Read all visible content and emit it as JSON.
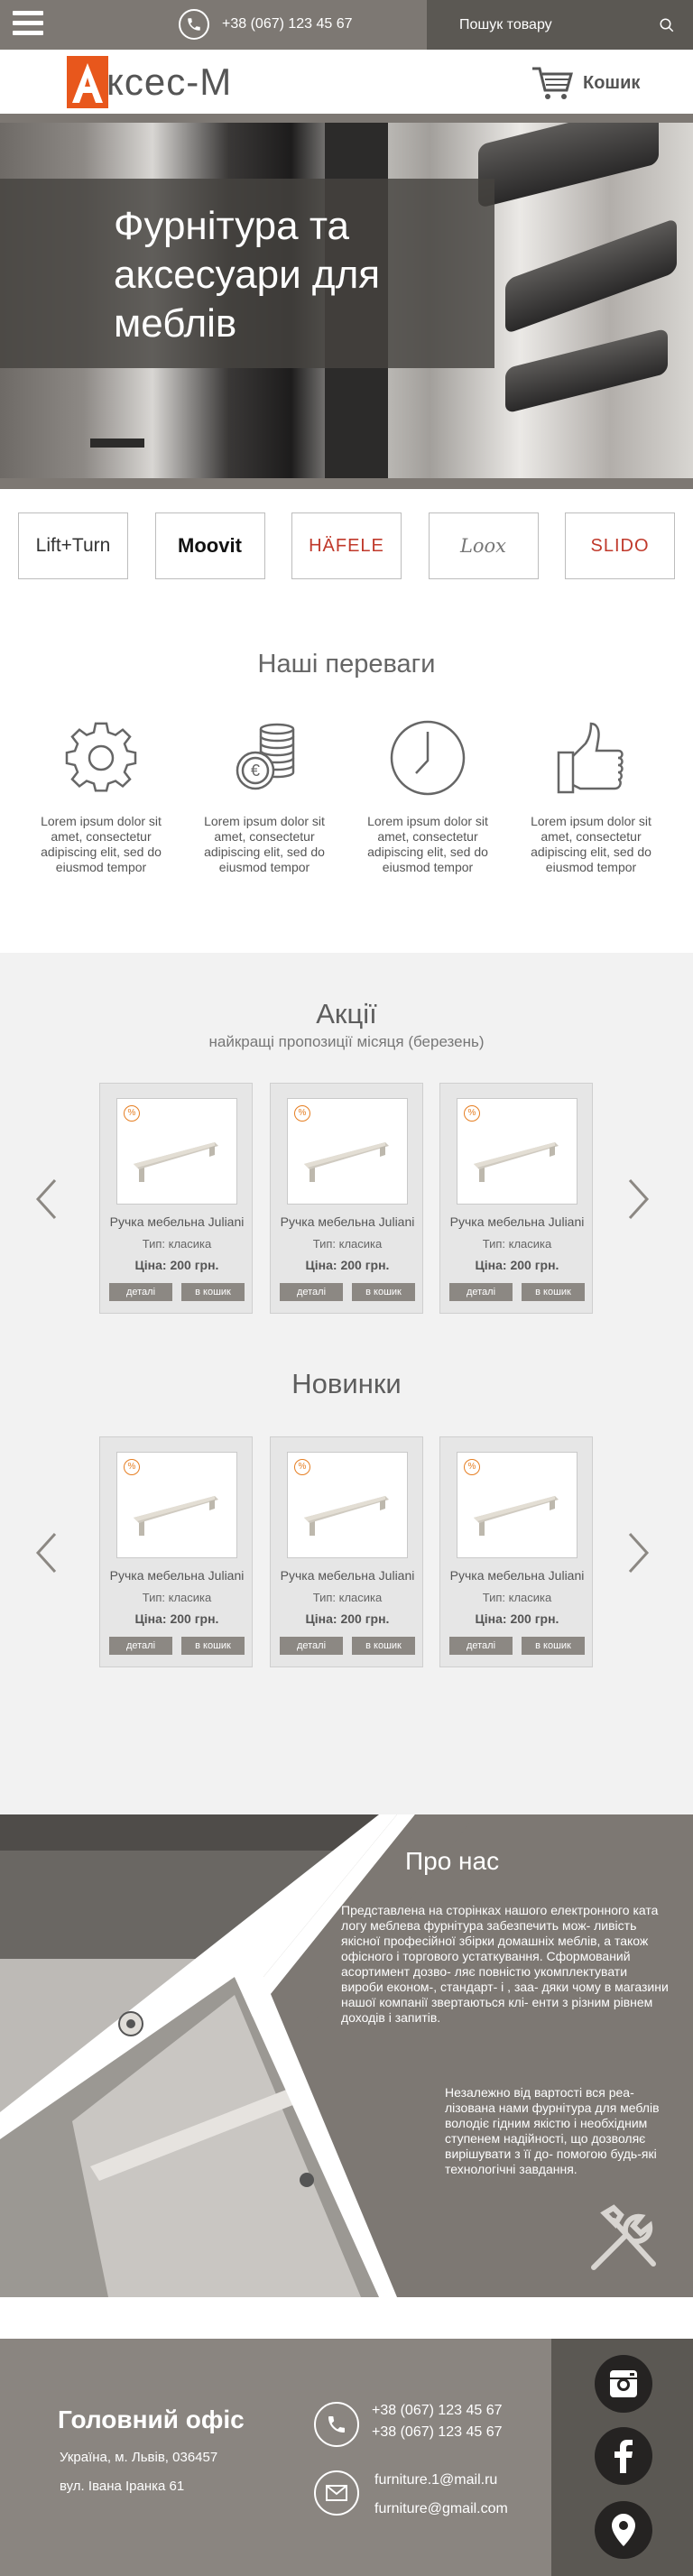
{
  "topbar": {
    "phone": "+38 (067) 123 45 67",
    "search_placeholder": "Пошук товару"
  },
  "header": {
    "logo_text": "ксес-М",
    "cart_label": "Кошик"
  },
  "hero": {
    "title": "Фурнітура та аксесуари для меблів"
  },
  "brands": [
    "Lift+Turn",
    "Moovit",
    "HÄFELE",
    "Loox",
    "SLIDO"
  ],
  "advantages": {
    "title": "Наші переваги",
    "items": [
      {
        "icon": "gear-icon",
        "text": "Lorem ipsum dolor sit amet, consectetur adipiscing elit, sed do eiusmod tempor"
      },
      {
        "icon": "coins-icon",
        "text": "Lorem ipsum dolor sit amet, consectetur adipiscing elit, sed do eiusmod tempor"
      },
      {
        "icon": "clock-icon",
        "text": "Lorem ipsum dolor sit amet, consectetur adipiscing elit, sed do eiusmod tempor"
      },
      {
        "icon": "thumbs-up-icon",
        "text": "Lorem ipsum dolor sit amet, consectetur adipiscing elit, sed do eiusmod tempor"
      }
    ]
  },
  "promo": {
    "title": "Акції",
    "subtitle": "найкращі пропозиції місяця (березень)",
    "products": [
      {
        "badge": "%",
        "name": "Ручка мебельна Juliani",
        "type": "Тип: класика",
        "price": "Ціна: 200 грн.",
        "details": "деталі",
        "cart": "в кошик"
      },
      {
        "badge": "%",
        "name": "Ручка мебельна Juliani",
        "type": "Тип: класика",
        "price": "Ціна: 200 грн.",
        "details": "деталі",
        "cart": "в кошик"
      },
      {
        "badge": "%",
        "name": "Ручка мебельна Juliani",
        "type": "Тип: класика",
        "price": "Ціна: 200 грн.",
        "details": "деталі",
        "cart": "в кошик"
      }
    ]
  },
  "novelties": {
    "title": "Новинки",
    "products": [
      {
        "badge": "%",
        "name": "Ручка мебельна Juliani",
        "type": "Тип: класика",
        "price": "Ціна: 200 грн.",
        "details": "деталі",
        "cart": "в кошик"
      },
      {
        "badge": "%",
        "name": "Ручка мебельна Juliani",
        "type": "Тип: класика",
        "price": "Ціна: 200 грн.",
        "details": "деталі",
        "cart": "в кошик"
      },
      {
        "badge": "%",
        "name": "Ручка мебельна Juliani",
        "type": "Тип: класика",
        "price": "Ціна: 200 грн.",
        "details": "деталі",
        "cart": "в кошик"
      }
    ]
  },
  "about": {
    "title": "Про нас",
    "p1": "Представлена на сторінках нашого електронного ката логу меблева фурнітура забезпечить мож- ливість якісної професійної збірки домашніх меблів, а також офісного і торгового устаткування. Сформований асортимент дозво- ляє повністю укомплектувати вироби економ-, стандарт- і , заа- дяки чому в магазини нашої компанії звертаються клі- енти з різним рівнем доходів і запитів.",
    "p2": "Незалежно від вартості вся реа- лізована нами фурнітура для меблів володіє гідним якістю і необхідним ступенем надійності, що дозволяє вирішувати з її до- помогою будь-які технологічні завдання."
  },
  "footer": {
    "title": "Головний офіс",
    "address_line1": "Україна, м. Львів, 036457",
    "address_line2": "вул. Івана Іранка 61",
    "phone1": "+38 (067) 123 45 67",
    "phone2": "+38 (067) 123 45 67",
    "email1": "furniture.1@mail.ru",
    "email2": "furniture@gmail.com"
  },
  "colors": {
    "accent": "#e8571c",
    "bar": "#7d7873",
    "dark_bar": "#5b5853"
  }
}
